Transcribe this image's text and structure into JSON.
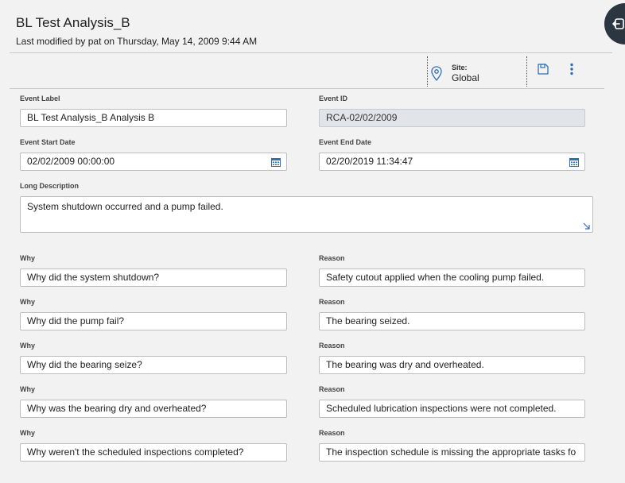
{
  "header": {
    "title": "BL Test Analysis_B",
    "subtitle": "Last modified by pat on Thursday, May 14, 2009 9:44 AM"
  },
  "toolbar": {
    "site_label": "Site:",
    "site_value": "Global"
  },
  "form": {
    "event_label": {
      "label": "Event Label",
      "value": "BL Test Analysis_B  Analysis B"
    },
    "event_id": {
      "label": "Event ID",
      "value": "RCA-02/02/2009"
    },
    "event_start": {
      "label": "Event Start Date",
      "value": "02/02/2009 00:00:00"
    },
    "event_end": {
      "label": "Event End Date",
      "value": "02/20/2019 11:34:47"
    },
    "long_description": {
      "label": "Long Description",
      "value": "System shutdown occurred and a pump failed."
    }
  },
  "whys": {
    "why_label": "Why",
    "reason_label": "Reason",
    "rows": [
      {
        "why": "Why did the system shutdown?",
        "reason": "Safety cutout applied when the cooling pump failed."
      },
      {
        "why": "Why did the pump fail?",
        "reason": "The bearing seized."
      },
      {
        "why": "Why did the bearing seize?",
        "reason": "The bearing was dry and overheated."
      },
      {
        "why": "Why was the bearing dry and overheated?",
        "reason": "Scheduled lubrication inspections were not completed."
      },
      {
        "why": "Why weren't the scheduled inspections completed?",
        "reason": "The inspection schedule is missing the appropriate tasks fo"
      }
    ]
  },
  "colors": {
    "accent": "#2f6fb5",
    "sidebar_button": "#2b3640"
  },
  "icons": {
    "pin": "map-pin-icon",
    "save": "save-icon",
    "more": "more-vertical-icon",
    "calendar": "calendar-icon",
    "exit": "exit-icon"
  }
}
